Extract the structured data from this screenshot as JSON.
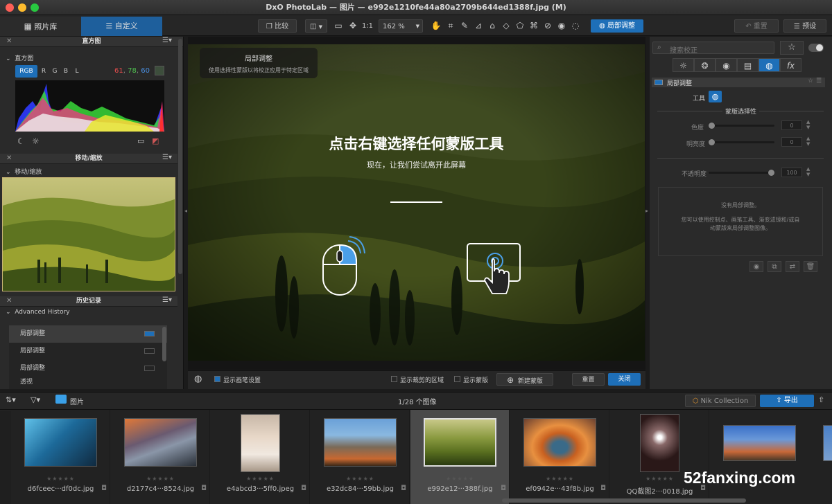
{
  "window": {
    "title": "DxO PhotoLab — 图片 — e992e1210fe44a80a2709b644ed1388f.jpg (M)"
  },
  "top_tabs": {
    "library": "照片库",
    "customize": "自定义"
  },
  "toolbar": {
    "compare": "比较",
    "ratio": "1:1",
    "zoom": "162 %",
    "local_adjust": "局部调整",
    "reset": "重置",
    "presets": "预设"
  },
  "left": {
    "histogram_header": "直方图",
    "histogram_sub": "直方图",
    "channels": [
      "RGB",
      "R",
      "G",
      "B",
      "L"
    ],
    "rgb_r": "61",
    "rgb_g": "78",
    "rgb_b": "60",
    "move_zoom_header": "移动/缩放",
    "move_zoom_sub": "移动/缩放",
    "history_header": "历史记录",
    "history_sub": "Advanced History",
    "history_items": [
      "局部调整",
      "局部调整",
      "局部调整",
      "透视"
    ]
  },
  "center": {
    "overlay_title": "局部调整",
    "overlay_desc": "使用选择性蒙版以将校正应用于特定区域",
    "big_text": "点击右键选择任何蒙版工具",
    "small_text": "现在，让我们尝试离开此屏幕",
    "show_brush": "显示画笔设置",
    "show_crop": "显示裁剪的区域",
    "show_mask": "显示蒙版",
    "new_mask": "新建蒙版",
    "reset": "重置",
    "close": "关闭"
  },
  "right": {
    "search_placeholder": "搜索校正",
    "panel_title": "局部调整",
    "tool_label": "工具",
    "mask_selectivity": "蒙版选择性",
    "hue": "色度",
    "hue_value": "0",
    "brightness": "明亮度",
    "brightness_value": "0",
    "opacity": "不透明度",
    "opacity_value": "100",
    "empty_title": "没有局部调整。",
    "empty_desc_1": "您可以使用控制点、画笔工具、渐变滤镜和/或自",
    "empty_desc_2": "动蒙版来局部调整图像。"
  },
  "filmbar": {
    "folder": "图片",
    "count": "1/28 个图像",
    "nik": "Nik Collection",
    "export": "导出"
  },
  "film": [
    {
      "name": "d6fceec···df0dc.jpg"
    },
    {
      "name": "d2177c4···8524.jpg"
    },
    {
      "name": "e4abcd3···5ff0.jpeg"
    },
    {
      "name": "e32dc84···59bb.jpg"
    },
    {
      "name": "e992e12···388f.jpg"
    },
    {
      "name": "ef0942e···43f8b.jpg"
    },
    {
      "name": "QQ截图2···0018.jpg"
    },
    {
      "name": ""
    }
  ],
  "stars": "★★★★★",
  "watermark": "52fanxing.com",
  "colors": {
    "accent": "#1e6fb8",
    "r": "#e64d4d",
    "g": "#4fc24f",
    "b": "#4a8fe0"
  }
}
